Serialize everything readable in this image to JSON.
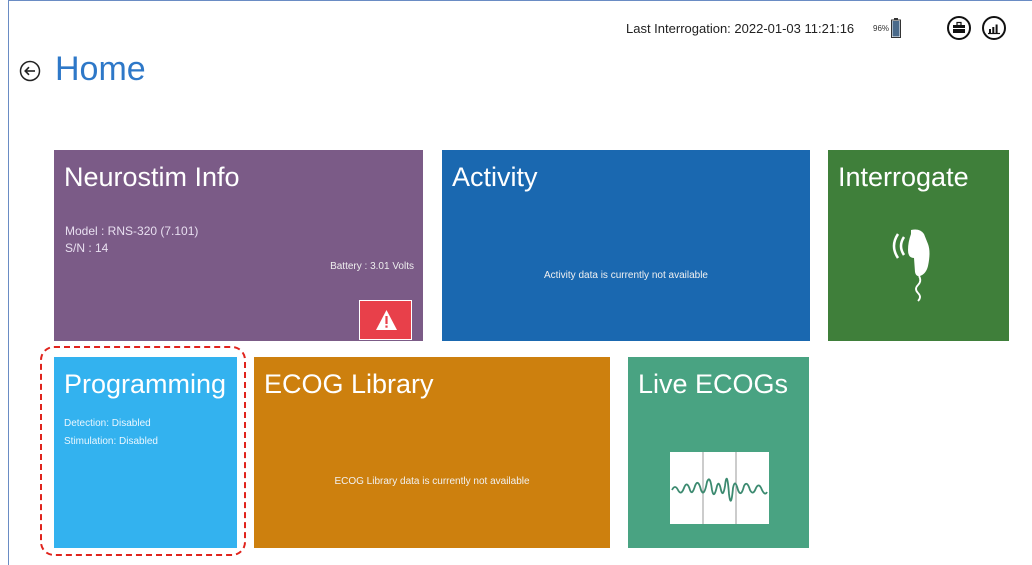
{
  "header": {
    "last_interrogation": "Last Interrogation: 2022-01-03 11:21:16",
    "battery_percent": "96%",
    "battery_level": 0.96,
    "toolbox_icon": "toolbox-icon",
    "signal_icon": "signal-icon"
  },
  "page": {
    "title": "Home",
    "back_icon": "back-arrow-icon"
  },
  "tiles": {
    "neurostim": {
      "title": "Neurostim Info",
      "model": "Model : RNS-320 (7.101)",
      "serial": "S/N : 14",
      "battery": "Battery : 3.01 Volts",
      "alert_icon": "warning-icon",
      "color": "#7b5b87"
    },
    "activity": {
      "title": "Activity",
      "message": "Activity data is currently not available",
      "color": "#1a68b0"
    },
    "interrogate": {
      "title": "Interrogate",
      "icon": "wand-signal-icon",
      "color": "#3f7f3a"
    },
    "programming": {
      "title": "Programming",
      "detection": "Detection: Disabled",
      "stimulation": "Stimulation: Disabled",
      "color": "#33b2ef"
    },
    "ecog_library": {
      "title": "ECOG Library",
      "message": "ECOG Library data is currently not available",
      "color": "#cd800e"
    },
    "live_ecogs": {
      "title": "Live ECOGs",
      "icon": "ecog-waveform-icon",
      "color": "#49a382"
    }
  },
  "annotation": {
    "highlight_color": "#e0231c"
  }
}
